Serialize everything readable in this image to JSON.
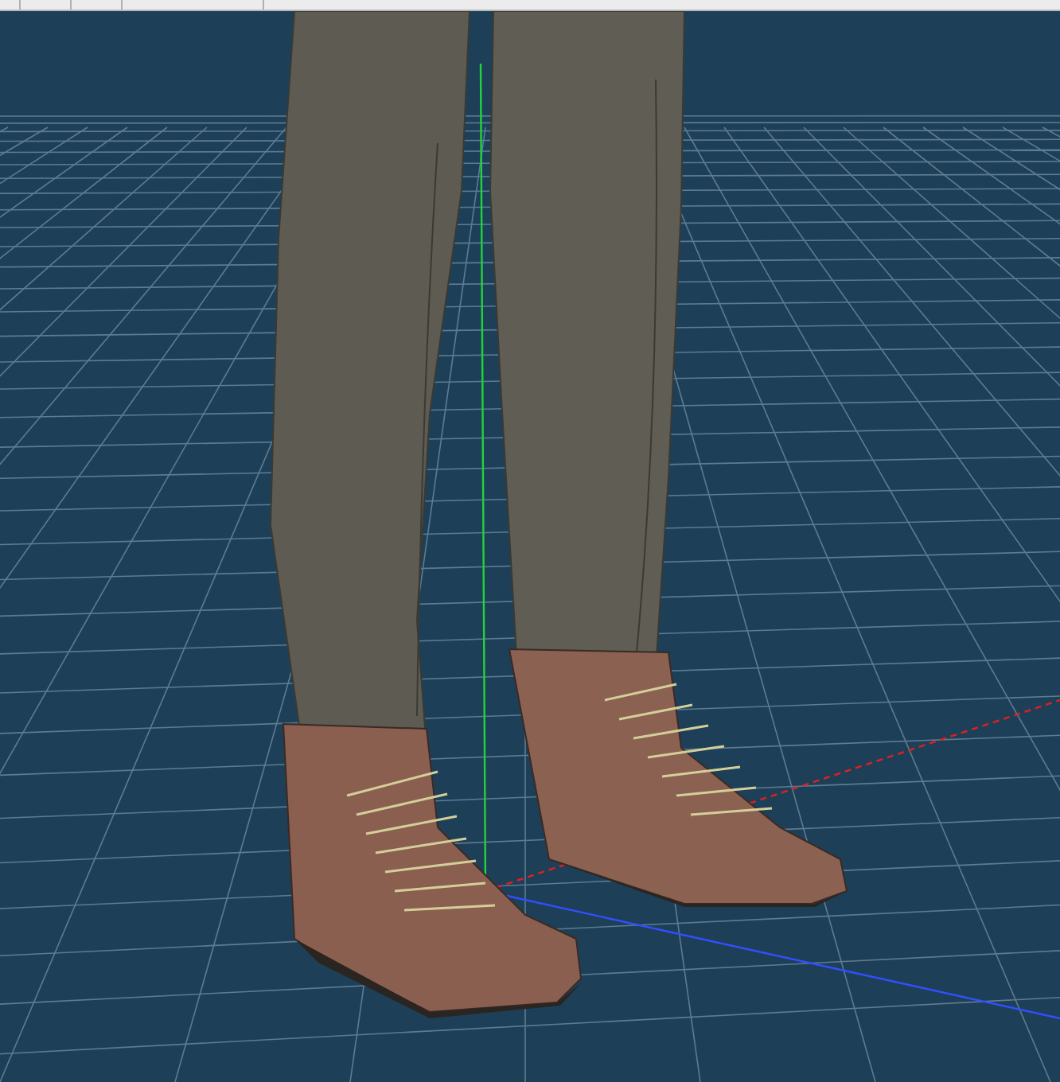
{
  "toolbar": {
    "kind": "strip"
  },
  "viewport": {
    "kind": "scene"
  }
}
